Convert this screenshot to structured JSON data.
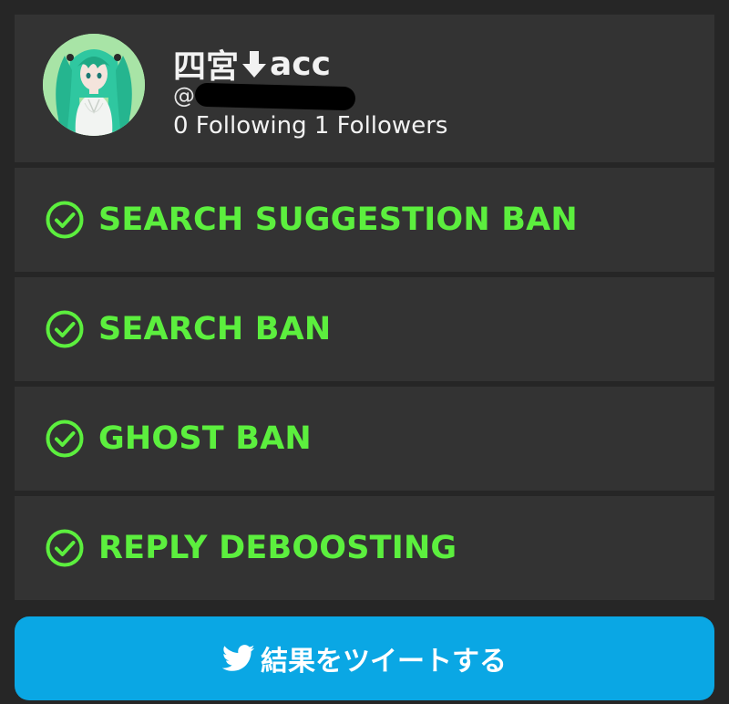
{
  "profile": {
    "name_prefix": "四宮",
    "name_suffix": "acc",
    "handle": "@",
    "stats": "0 Following 1 Followers"
  },
  "checks": [
    {
      "label": "SEARCH SUGGESTION BAN",
      "icon": "check-circle-icon"
    },
    {
      "label": "SEARCH BAN",
      "icon": "check-circle-icon"
    },
    {
      "label": "GHOST BAN",
      "icon": "check-circle-icon"
    },
    {
      "label": "REPLY DEBOOSTING",
      "icon": "check-circle-icon"
    }
  ],
  "tweet_button": {
    "label": "結果をツイートする",
    "icon": "twitter-bird-icon"
  },
  "colors": {
    "background": "#262626",
    "card": "#333333",
    "accent_green": "#5cef3e",
    "button_blue": "#0aa7e4"
  }
}
